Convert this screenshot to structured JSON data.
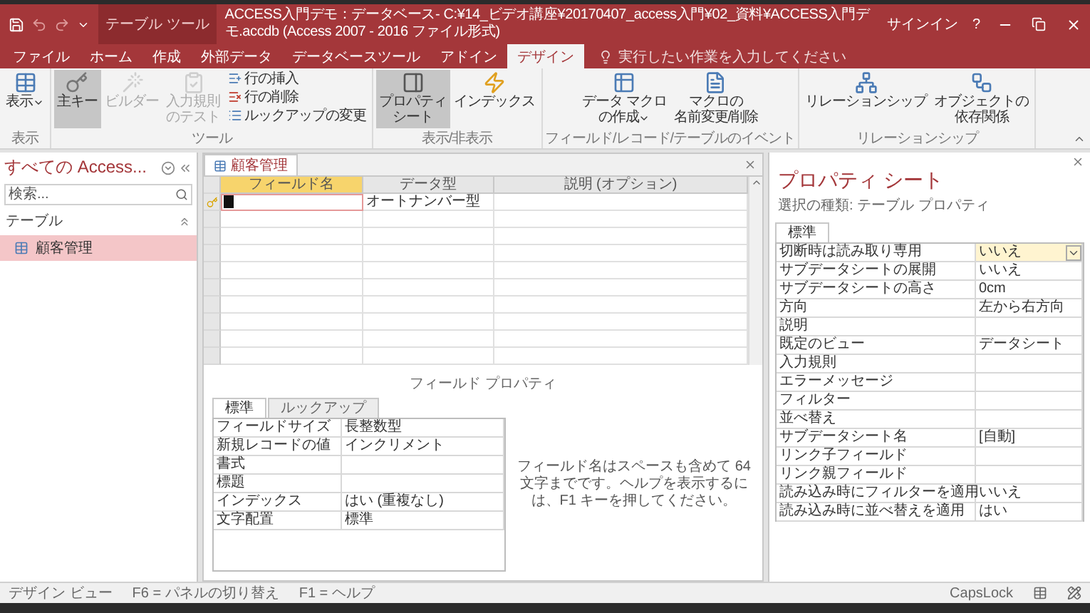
{
  "title_bar": {
    "context_label": "テーブル ツール",
    "title": "ACCESS入門デモ：データベース- C:¥14_ビデオ講座¥20170407_access入門¥02_資料¥ACCESS入門デモ.accdb (Access 2007 - 2016 ファイル形式)",
    "sign_in": "サインイン",
    "help": "?"
  },
  "ribbon": {
    "tabs": [
      {
        "label": "ファイル",
        "selected": false
      },
      {
        "label": "ホーム",
        "selected": false
      },
      {
        "label": "作成",
        "selected": false
      },
      {
        "label": "外部データ",
        "selected": false
      },
      {
        "label": "データベースツール",
        "selected": false
      },
      {
        "label": "アドイン",
        "selected": false
      },
      {
        "label": "デザイン",
        "selected": true
      }
    ],
    "tell_me": "実行したい作業を入力してください",
    "groups": [
      {
        "label": "表示",
        "buttons": [
          {
            "kind": "large",
            "label_lines": [
              "表示"
            ],
            "dropdown": true,
            "pressed": false,
            "disabled": false
          }
        ]
      },
      {
        "label": "ツール",
        "buttons": [
          {
            "kind": "large",
            "label_lines": [
              "主キー"
            ],
            "dropdown": false,
            "pressed": true,
            "disabled": false
          },
          {
            "kind": "large",
            "label_lines": [
              "ビルダー"
            ],
            "dropdown": false,
            "pressed": false,
            "disabled": true
          },
          {
            "kind": "large",
            "label_lines": [
              "入力規則",
              "のテスト"
            ],
            "dropdown": false,
            "pressed": false,
            "disabled": true
          },
          {
            "kind": "small",
            "label_lines": [
              "行の挿入"
            ],
            "dropdown": false,
            "pressed": false,
            "disabled": false
          },
          {
            "kind": "small",
            "label_lines": [
              "行の削除"
            ],
            "dropdown": false,
            "pressed": false,
            "disabled": false
          },
          {
            "kind": "small",
            "label_lines": [
              "ルックアップの変更"
            ],
            "dropdown": false,
            "pressed": false,
            "disabled": false
          }
        ]
      },
      {
        "label": "表示/非表示",
        "buttons": [
          {
            "kind": "large",
            "label_lines": [
              "プロパティ",
              "シート"
            ],
            "dropdown": false,
            "pressed": true,
            "disabled": false
          },
          {
            "kind": "large",
            "label_lines": [
              "インデックス"
            ],
            "dropdown": false,
            "pressed": false,
            "disabled": false
          }
        ]
      },
      {
        "label": "フィールド/レコード/テーブルのイベント",
        "buttons": [
          {
            "kind": "large",
            "label_lines": [
              "データ マクロ",
              "の作成"
            ],
            "dropdown": true,
            "pressed": false,
            "disabled": false
          },
          {
            "kind": "large",
            "label_lines": [
              "マクロの",
              "名前変更/削除"
            ],
            "dropdown": false,
            "pressed": false,
            "disabled": false
          }
        ]
      },
      {
        "label": "リレーションシップ",
        "buttons": [
          {
            "kind": "large",
            "label_lines": [
              "リレーションシップ"
            ],
            "dropdown": false,
            "pressed": false,
            "disabled": false
          },
          {
            "kind": "large",
            "label_lines": [
              "オブジェクトの",
              "依存関係"
            ],
            "dropdown": false,
            "pressed": false,
            "disabled": false
          }
        ]
      }
    ]
  },
  "nav_pane": {
    "title": "すべての Access...",
    "search_placeholder": "検索...",
    "groups": [
      {
        "label": "テーブル",
        "expanded": true,
        "items": [
          {
            "label": "顧客管理",
            "selected": true
          }
        ]
      }
    ]
  },
  "document_tabs": [
    {
      "label": "顧客管理",
      "selected": true
    }
  ],
  "design_grid": {
    "columns": [
      {
        "label": "フィールド名",
        "selected": true
      },
      {
        "label": "データ型",
        "selected": false
      },
      {
        "label": "説明 (オプション)",
        "selected": false
      }
    ],
    "rows": [
      {
        "primary_key": true,
        "selected": true,
        "data_type": "オートナンバー型"
      }
    ]
  },
  "field_properties": {
    "title": "フィールド プロパティ",
    "tabs": [
      {
        "label": "標準",
        "selected": true
      },
      {
        "label": "ルックアップ",
        "selected": false
      }
    ],
    "rows": [
      {
        "label": "フィールドサイズ",
        "value": "長整数型"
      },
      {
        "label": "新規レコードの値",
        "value": "インクリメント"
      },
      {
        "label": "書式"
      },
      {
        "label": "標題"
      },
      {
        "label": "インデックス",
        "value": "はい (重複なし)"
      },
      {
        "label": "文字配置",
        "value": "標準"
      }
    ],
    "help": "フィールド名はスペースも含めて 64 文字までです。ヘルプを表示するには、F1 キーを押してください。"
  },
  "property_sheet": {
    "title": "プロパティ シート",
    "subtitle": "選択の種類: テーブル プロパティ",
    "tabs": [
      {
        "label": "標準",
        "selected": true
      }
    ],
    "rows": [
      {
        "label": "切断時は読み取り専用",
        "value": "いいえ",
        "selected": true
      },
      {
        "label": "サブデータシートの展開",
        "value": "いいえ",
        "selected": false
      },
      {
        "label": "サブデータシートの高さ",
        "value": "0cm",
        "selected": false
      },
      {
        "label": "方向",
        "value": "左から右方向",
        "selected": false
      },
      {
        "label": "説明",
        "selected": false
      },
      {
        "label": "既定のビュー",
        "value": "データシート",
        "selected": false
      },
      {
        "label": "入力規則",
        "selected": false
      },
      {
        "label": "エラーメッセージ",
        "selected": false
      },
      {
        "label": "フィルター",
        "selected": false
      },
      {
        "label": "並べ替え",
        "selected": false
      },
      {
        "label": "サブデータシート名",
        "value": "[自動]",
        "selected": false
      },
      {
        "label": "リンク子フィールド",
        "selected": false
      },
      {
        "label": "リンク親フィールド",
        "selected": false
      },
      {
        "label": "読み込み時にフィルターを適用",
        "value": "いいえ",
        "selected": false
      },
      {
        "label": "読み込み時に並べ替えを適用",
        "value": "はい",
        "selected": false
      }
    ]
  },
  "status_bar": {
    "items": [
      "デザイン ビュー",
      "F6 = パネルの切り替え",
      "F1 = ヘルプ"
    ],
    "caps_lock": "CapsLock"
  }
}
